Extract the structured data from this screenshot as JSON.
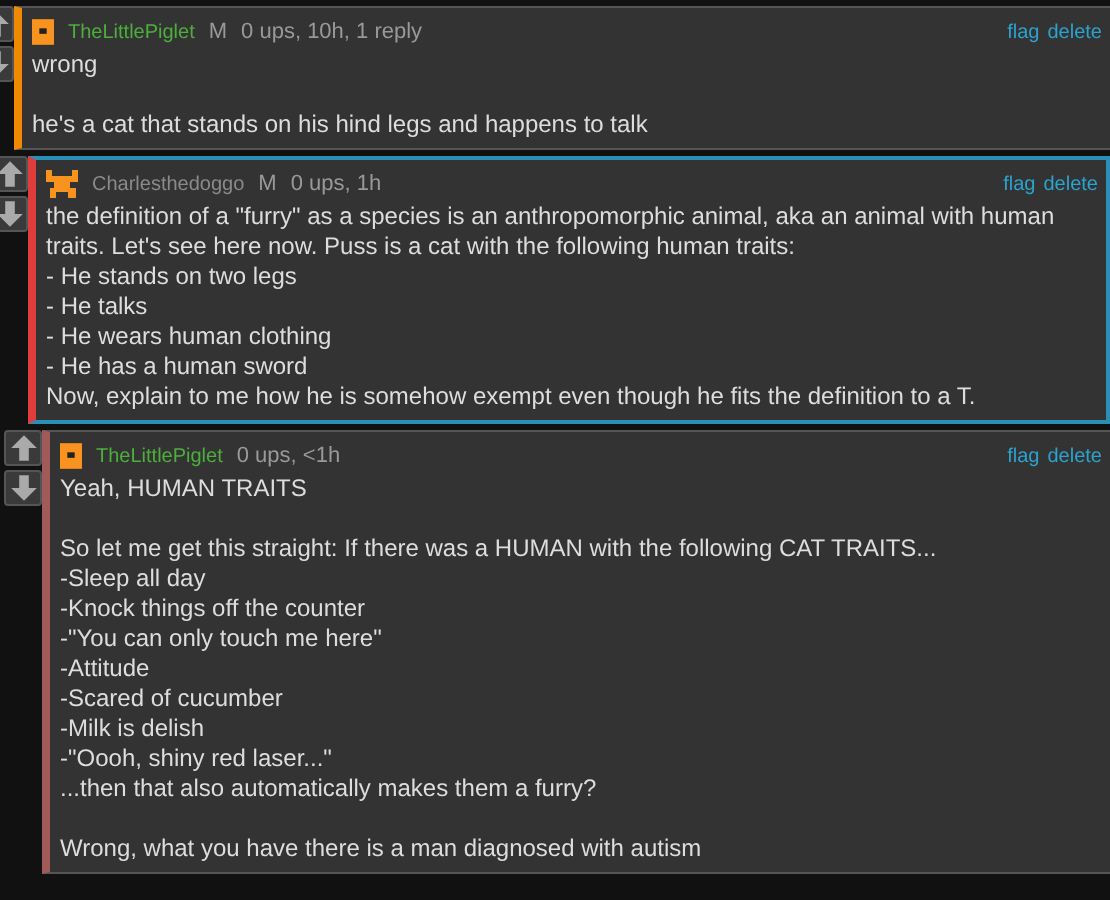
{
  "comments": [
    {
      "avatar": {
        "kind": "square"
      },
      "user": {
        "name": "TheLittlePiglet",
        "color": "#4caf3c"
      },
      "badge": "M",
      "meta": "0 ups, 10h, 1 reply",
      "actions": [
        "flag",
        "delete"
      ],
      "color": "#f08a00",
      "highlighted": false,
      "paragraphs": [
        "wrong",
        "he's a cat that stands on his hind legs and happens to talk"
      ],
      "children": [
        {
          "avatar": {
            "kind": "creature"
          },
          "user": {
            "name": "Charlesthedoggo",
            "color": "#8a8a8a"
          },
          "badge": "M",
          "meta": "0 ups, 1h",
          "actions": [
            "flag",
            "delete"
          ],
          "color": "#e03c3c",
          "highlighted": true,
          "paragraphs": [
            "the definition of a \"furry\" as a species is an anthropomorphic animal, aka an animal with human traits. Let's see here now. Puss is a cat with the following human traits:\n- He stands on two legs\n- He talks\n- He wears human clothing\n- He has a human sword\nNow, explain to me how he is somehow exempt even though he fits the definition to a T."
          ],
          "children": [
            {
              "avatar": {
                "kind": "square"
              },
              "user": {
                "name": "TheLittlePiglet",
                "color": "#4caf3c"
              },
              "meta": "0 ups, <1h",
              "actions": [
                "flag",
                "delete"
              ],
              "color": "#a05a5a",
              "highlighted": false,
              "paragraphs": [
                "Yeah, HUMAN TRAITS",
                "So let me get this straight: If there was a HUMAN with the following CAT TRAITS...\n-Sleep all day\n-Knock things off the counter\n-\"You can only touch me here\"\n-Attitude\n-Scared of cucumber\n-Milk is delish\n-\"Oooh, shiny red laser...\"\n...then that also automatically makes them a furry?",
                "Wrong, what you have there is a man diagnosed with autism"
              ]
            }
          ]
        }
      ]
    }
  ]
}
